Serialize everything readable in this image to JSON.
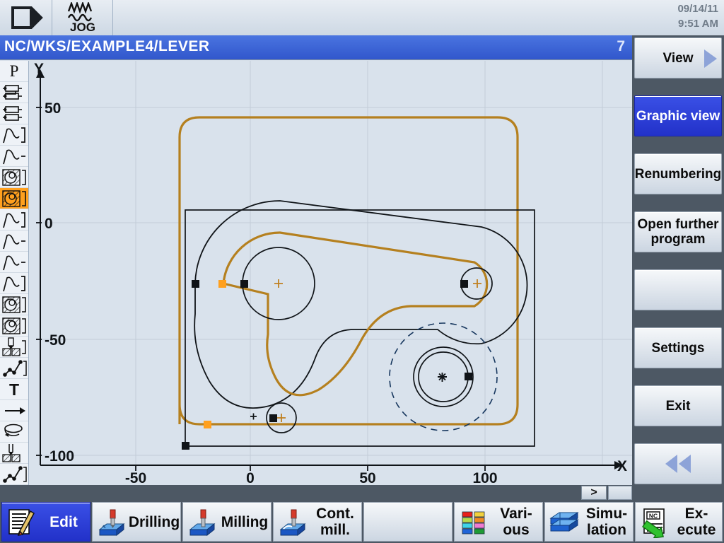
{
  "header": {
    "channel_icon": "channel-arrow-icon",
    "mode_icon": "jog-wave-icon",
    "mode_label": "JOG",
    "date": "09/14/11",
    "time": "9:51 AM"
  },
  "title": {
    "path": "NC/WKS/EXAMPLE4/LEVER",
    "block_number": "7"
  },
  "left_toolbar": {
    "items": [
      {
        "name": "program-icon",
        "glyph": "P",
        "selected": false
      },
      {
        "name": "subroutine-call-icon",
        "glyph": "",
        "selected": false
      },
      {
        "name": "subroutine-call-2-icon",
        "glyph": "",
        "selected": false
      },
      {
        "name": "contour-curve-1-icon",
        "glyph": "",
        "selected": false
      },
      {
        "name": "contour-curve-2-icon",
        "glyph": "",
        "selected": false
      },
      {
        "name": "pocket-circular-icon",
        "glyph": "",
        "selected": false
      },
      {
        "name": "pocket-circular-selected-icon",
        "glyph": "",
        "selected": true
      },
      {
        "name": "contour-curve-3-icon",
        "glyph": "",
        "selected": false
      },
      {
        "name": "contour-curve-4-icon",
        "glyph": "",
        "selected": false
      },
      {
        "name": "contour-curve-5-icon",
        "glyph": "",
        "selected": false
      },
      {
        "name": "contour-curve-6-icon",
        "glyph": "",
        "selected": false
      },
      {
        "name": "pocket-circular-2-icon",
        "glyph": "",
        "selected": false
      },
      {
        "name": "pocket-circular-3-icon",
        "glyph": "",
        "selected": false
      },
      {
        "name": "drill-hole-icon",
        "glyph": "",
        "selected": false
      },
      {
        "name": "position-pattern-icon",
        "glyph": "",
        "selected": false
      },
      {
        "name": "tool-icon",
        "glyph": "T",
        "selected": false
      },
      {
        "name": "linear-move-icon",
        "glyph": "",
        "selected": false
      },
      {
        "name": "helix-icon",
        "glyph": "",
        "selected": false
      },
      {
        "name": "drill-hole-2-icon",
        "glyph": "",
        "selected": false
      },
      {
        "name": "position-pattern-2-icon",
        "glyph": "",
        "selected": false
      },
      {
        "name": "end-of-program-icon",
        "glyph": "",
        "selected": false
      }
    ]
  },
  "graphic": {
    "x_axis_label": "X",
    "y_axis_label": "Y",
    "x_ticks": [
      "-50",
      "0",
      "50",
      "100"
    ],
    "y_ticks": [
      "50",
      "0",
      "-50",
      "-100"
    ],
    "grid": true,
    "colors": {
      "background": "#d9e2ec",
      "grid": "#c3cdd9",
      "workpiece": "#101418",
      "toolpath": "#b07820",
      "marker": "#ffa01e",
      "accent": "#2231c9"
    }
  },
  "scrollbar": {
    "right_button": ">"
  },
  "softkeys_vertical": [
    {
      "label": "View",
      "name": "softkey-view",
      "active": false,
      "arrow": true
    },
    {
      "label": "Graphic view",
      "name": "softkey-graphic-view",
      "active": true,
      "arrow": false
    },
    {
      "label": "Renumbering",
      "name": "softkey-renumbering",
      "active": false,
      "arrow": false
    },
    {
      "label": "Open further program",
      "name": "softkey-open-further-program",
      "active": false,
      "arrow": false
    },
    {
      "label": "",
      "name": "softkey-empty-1",
      "active": false,
      "arrow": false
    },
    {
      "label": "Settings",
      "name": "softkey-settings",
      "active": false,
      "arrow": false
    },
    {
      "label": "Exit",
      "name": "softkey-exit",
      "active": false,
      "arrow": false
    },
    {
      "label": "",
      "name": "softkey-back",
      "active": false,
      "arrow": false
    }
  ],
  "softkeys_horizontal": [
    {
      "label": "Edit",
      "name": "hkey-edit",
      "icon": "edit-pencil-icon",
      "active": true
    },
    {
      "label": "Drilling",
      "name": "hkey-drilling",
      "icon": "drilling-icon",
      "active": false
    },
    {
      "label": "Milling",
      "name": "hkey-milling",
      "icon": "milling-icon",
      "active": false
    },
    {
      "label": "Cont. mill.",
      "name": "hkey-cont-mill",
      "icon": "contour-mill-icon",
      "active": false
    },
    {
      "label": "",
      "name": "hkey-empty",
      "icon": "",
      "active": false
    },
    {
      "label": "Vari- ous",
      "name": "hkey-various",
      "icon": "various-grid-icon",
      "active": false
    },
    {
      "label": "Simu- lation",
      "name": "hkey-simulation",
      "icon": "simulation-block-icon",
      "active": false
    },
    {
      "label": "Ex- ecute",
      "name": "hkey-execute",
      "icon": "nc-execute-icon",
      "active": false
    }
  ]
}
